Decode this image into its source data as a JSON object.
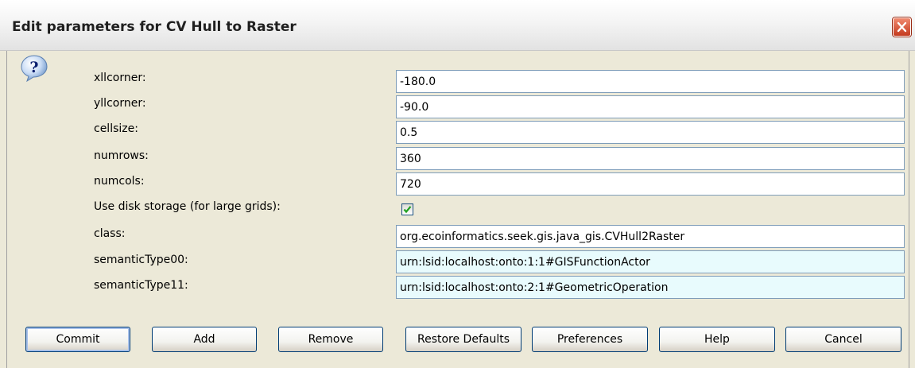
{
  "window": {
    "title": "Edit parameters for CV Hull to Raster"
  },
  "params": [
    {
      "label": "xllcorner:",
      "value": "-180.0"
    },
    {
      "label": "yllcorner:",
      "value": "-90.0"
    },
    {
      "label": "cellsize:",
      "value": "0.5"
    },
    {
      "label": "numrows:",
      "value": "360"
    },
    {
      "label": "numcols:",
      "value": "720"
    },
    {
      "label": "Use disk storage (for large grids):",
      "checked": true
    },
    {
      "label": "class:",
      "value": "org.ecoinformatics.seek.gis.java_gis.CVHull2Raster"
    },
    {
      "label": "semanticType00:",
      "value": "urn:lsid:localhost:onto:1:1#GISFunctionActor"
    },
    {
      "label": "semanticType11:",
      "value": "urn:lsid:localhost:onto:2:1#GeometricOperation"
    }
  ],
  "buttons": {
    "commit": "Commit",
    "add": "Add",
    "remove": "Remove",
    "restore_defaults": "Restore Defaults",
    "preferences": "Preferences",
    "help": "Help",
    "cancel": "Cancel"
  },
  "icons": {
    "dialog": "question-icon",
    "close": "close-icon",
    "check": "checkmark-icon"
  },
  "colors": {
    "accent": "#003c74",
    "close": "#c43a1e",
    "readonly_field": "#e8fbfd",
    "check": "#21a121"
  }
}
